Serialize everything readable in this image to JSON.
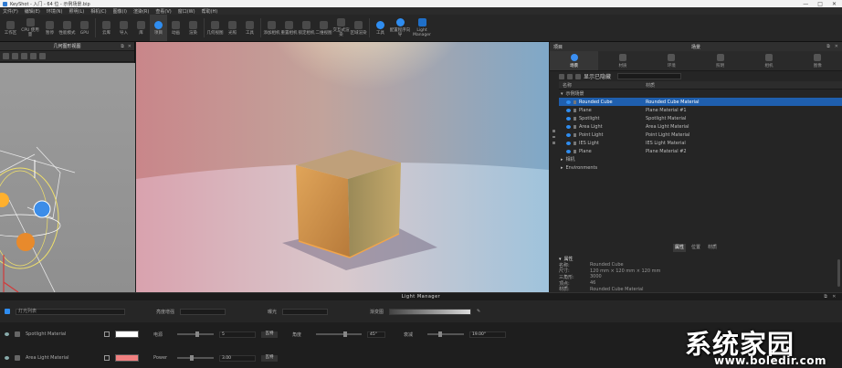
{
  "titlebar": {
    "title": "KeyShot - 入门 - 64 位 - 示例场景.bip",
    "minimize": "—",
    "maximize": "□",
    "close": "✕"
  },
  "menu": [
    "文件(F)",
    "编辑(E)",
    "环境(N)",
    "照明(L)",
    "相机(C)",
    "图像(I)",
    "渲染(R)",
    "查看(V)",
    "窗口(W)",
    "帮助(H)"
  ],
  "toolbar": {
    "items": [
      {
        "label": "工作区",
        "icon": "workspace-icon"
      },
      {
        "label": "CPU 使用量",
        "icon": "cpu-icon"
      },
      {
        "label": "暂停",
        "icon": "pause-icon"
      },
      {
        "label": "性能模式",
        "icon": "performance-icon"
      },
      {
        "label": "GPU",
        "icon": "gpu-icon"
      },
      {
        "label": "云库",
        "icon": "cloud-library-icon"
      },
      {
        "label": "导入",
        "icon": "import-icon"
      },
      {
        "label": "库",
        "icon": "library-icon"
      },
      {
        "label": "项目",
        "icon": "project-icon"
      },
      {
        "label": "动画",
        "icon": "animation-icon"
      },
      {
        "label": "渲染",
        "icon": "render-icon"
      },
      {
        "label": "几何视图",
        "icon": "geometry-view-icon"
      },
      {
        "label": "光照",
        "icon": "lighting-icon"
      },
      {
        "label": "工具",
        "icon": "tools-icon"
      },
      {
        "label": "添加相机",
        "icon": "add-camera-icon"
      },
      {
        "label": "重置相机",
        "icon": "reset-camera-icon"
      },
      {
        "label": "锁定相机",
        "icon": "lock-camera-icon"
      },
      {
        "label": "二维视图",
        "icon": "2d-view-icon"
      },
      {
        "label": "交互式渲染",
        "icon": "interactive-render-icon"
      },
      {
        "label": "区域渲染",
        "icon": "region-render-icon"
      },
      {
        "label": "工具",
        "icon": "tools-icon"
      },
      {
        "label": "配置程序向导",
        "icon": "configurator-icon"
      },
      {
        "label": "Light Manager",
        "icon": "light-manager-icon"
      }
    ]
  },
  "left_panel": {
    "title": "几何图形视图"
  },
  "right_panel": {
    "left_label": "项目",
    "title": "场景",
    "tabs": [
      {
        "label": "场景",
        "icon": "scene-icon"
      },
      {
        "label": "材质",
        "icon": "material-icon"
      },
      {
        "label": "环境",
        "icon": "environment-icon"
      },
      {
        "label": "照明",
        "icon": "lighting-icon"
      },
      {
        "label": "相机",
        "icon": "camera-icon"
      },
      {
        "label": "图像",
        "icon": "image-icon"
      }
    ],
    "search_label": "显示已隐藏",
    "columns": [
      "名称",
      "材质"
    ],
    "tree_root": "示例场景",
    "rows": [
      {
        "name": "Rounded Cube",
        "material": "Rounded Cube Material"
      },
      {
        "name": "Plane",
        "material": "Plane Material #1"
      },
      {
        "name": "Spotlight",
        "material": "Spotlight Material"
      },
      {
        "name": "Area Light",
        "material": "Area Light Material"
      },
      {
        "name": "Point Light",
        "material": "Point Light Material"
      },
      {
        "name": "IES Light",
        "material": "IES Light Material"
      },
      {
        "name": "Plane",
        "material": "Plane Material #2"
      }
    ],
    "groups": [
      "相机",
      "Environments"
    ],
    "subtabs": [
      "属性",
      "位置",
      "材质"
    ],
    "props_section": "属性",
    "props": [
      {
        "key": "名称:",
        "value": "Rounded Cube"
      },
      {
        "key": "尺寸:",
        "value": "120 mm × 120 mm × 120 mm"
      },
      {
        "key": "三角形:",
        "value": "3000"
      },
      {
        "key": "顶点:",
        "value": "46"
      },
      {
        "key": "材质:",
        "value": "Rounded Cube Material"
      },
      {
        "key": "原始材质:",
        "value": "Rounded Cube Material"
      }
    ]
  },
  "light_manager": {
    "title": "Light Manager",
    "search_value": "灯光列表",
    "label_brightness": "亮度增强",
    "label_exposure": "曝光",
    "label_gradient": "渐变图",
    "rows": [
      {
        "name": "Spotlight Material",
        "swatch_color": "#ffffff",
        "power_label": "电源",
        "power_value": "5",
        "unit": "瓦特",
        "angle_label": "角度",
        "angle_value": "45°",
        "falloff_label": "衰减",
        "falloff_value": "19.00°"
      },
      {
        "name": "Area Light Material",
        "swatch_color": "#f08080",
        "power_label": "Power",
        "power_value": "3.00",
        "unit": "瓦特"
      }
    ]
  },
  "watermark": {
    "brand": "系统家园",
    "url": "www.boledir.com"
  }
}
